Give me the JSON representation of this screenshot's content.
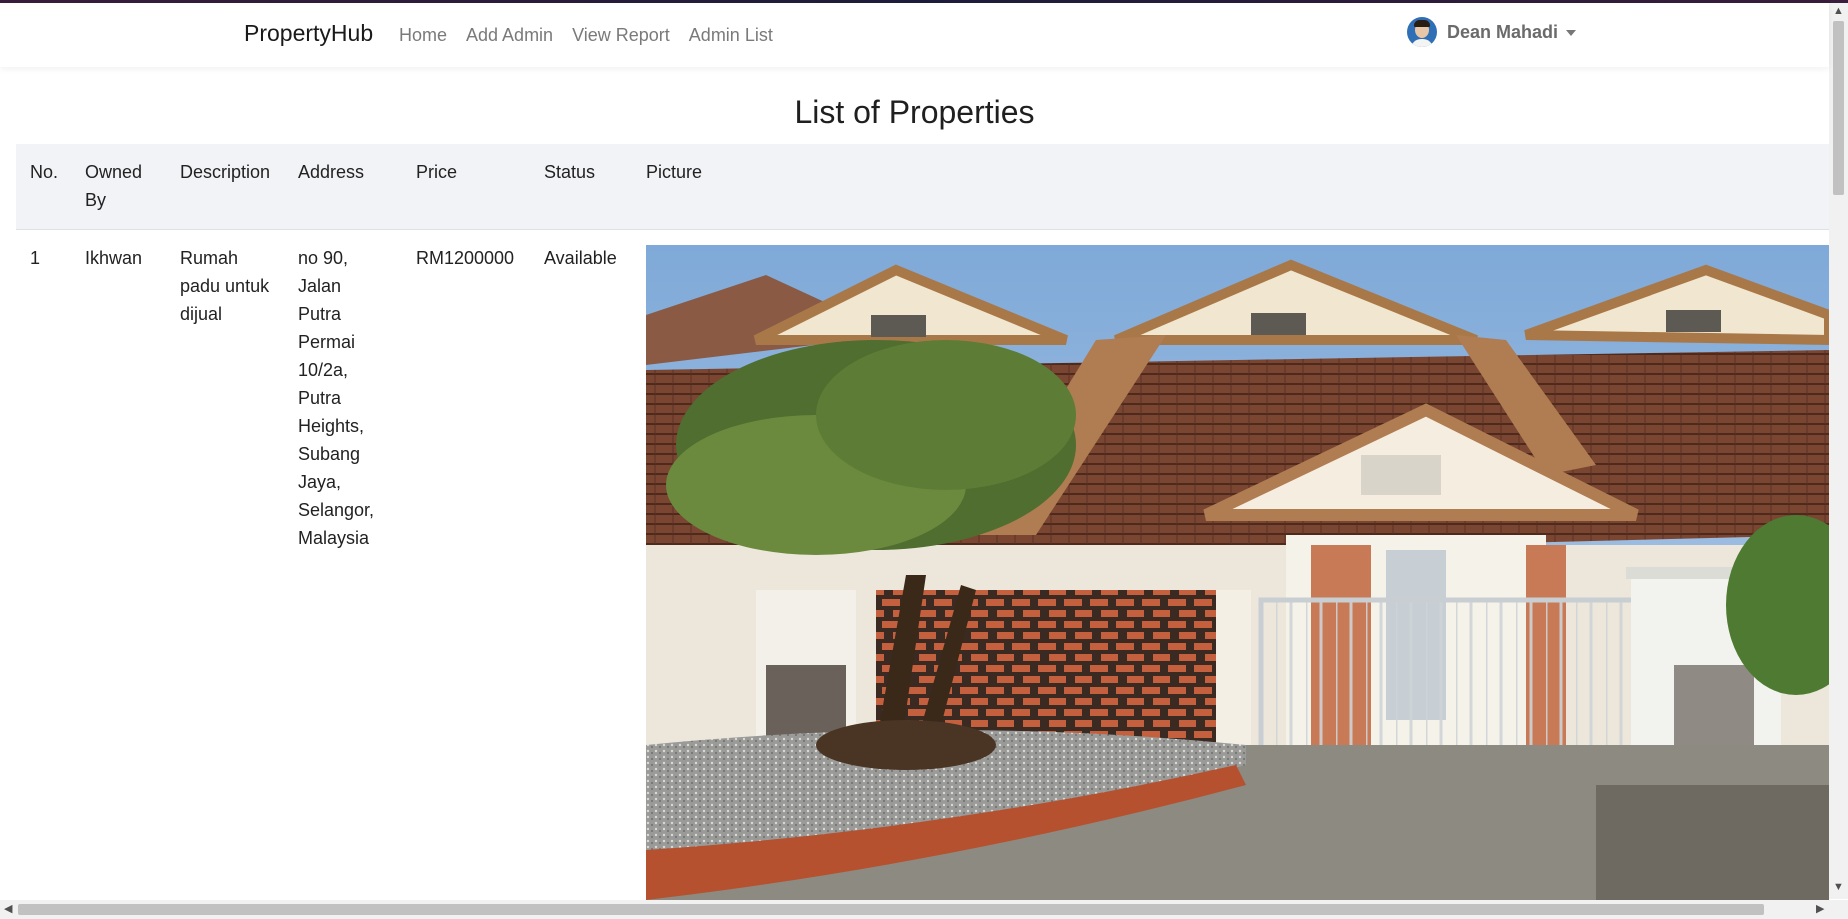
{
  "nav": {
    "brand": "PropertyHub",
    "links": [
      "Home",
      "Add Admin",
      "View Report",
      "Admin List"
    ],
    "user_name": "Dean Mahadi"
  },
  "page_title": "List of Properties",
  "table": {
    "headers": [
      "No.",
      "Owned By",
      "Description",
      "Address",
      "Price",
      "Status",
      "Picture"
    ],
    "rows": [
      {
        "no": "1",
        "owned_by": "Ikhwan",
        "description": "Rumah padu untuk dijual",
        "address": "no 90, Jalan Putra Permai 10/2a, Putra Heights, Subang Jaya, Selangor, Malaysia",
        "price": "RM1200000",
        "status": "Available"
      }
    ]
  },
  "icons": {
    "avatar": "user-avatar-icon",
    "caret": "chevron-down-icon"
  }
}
